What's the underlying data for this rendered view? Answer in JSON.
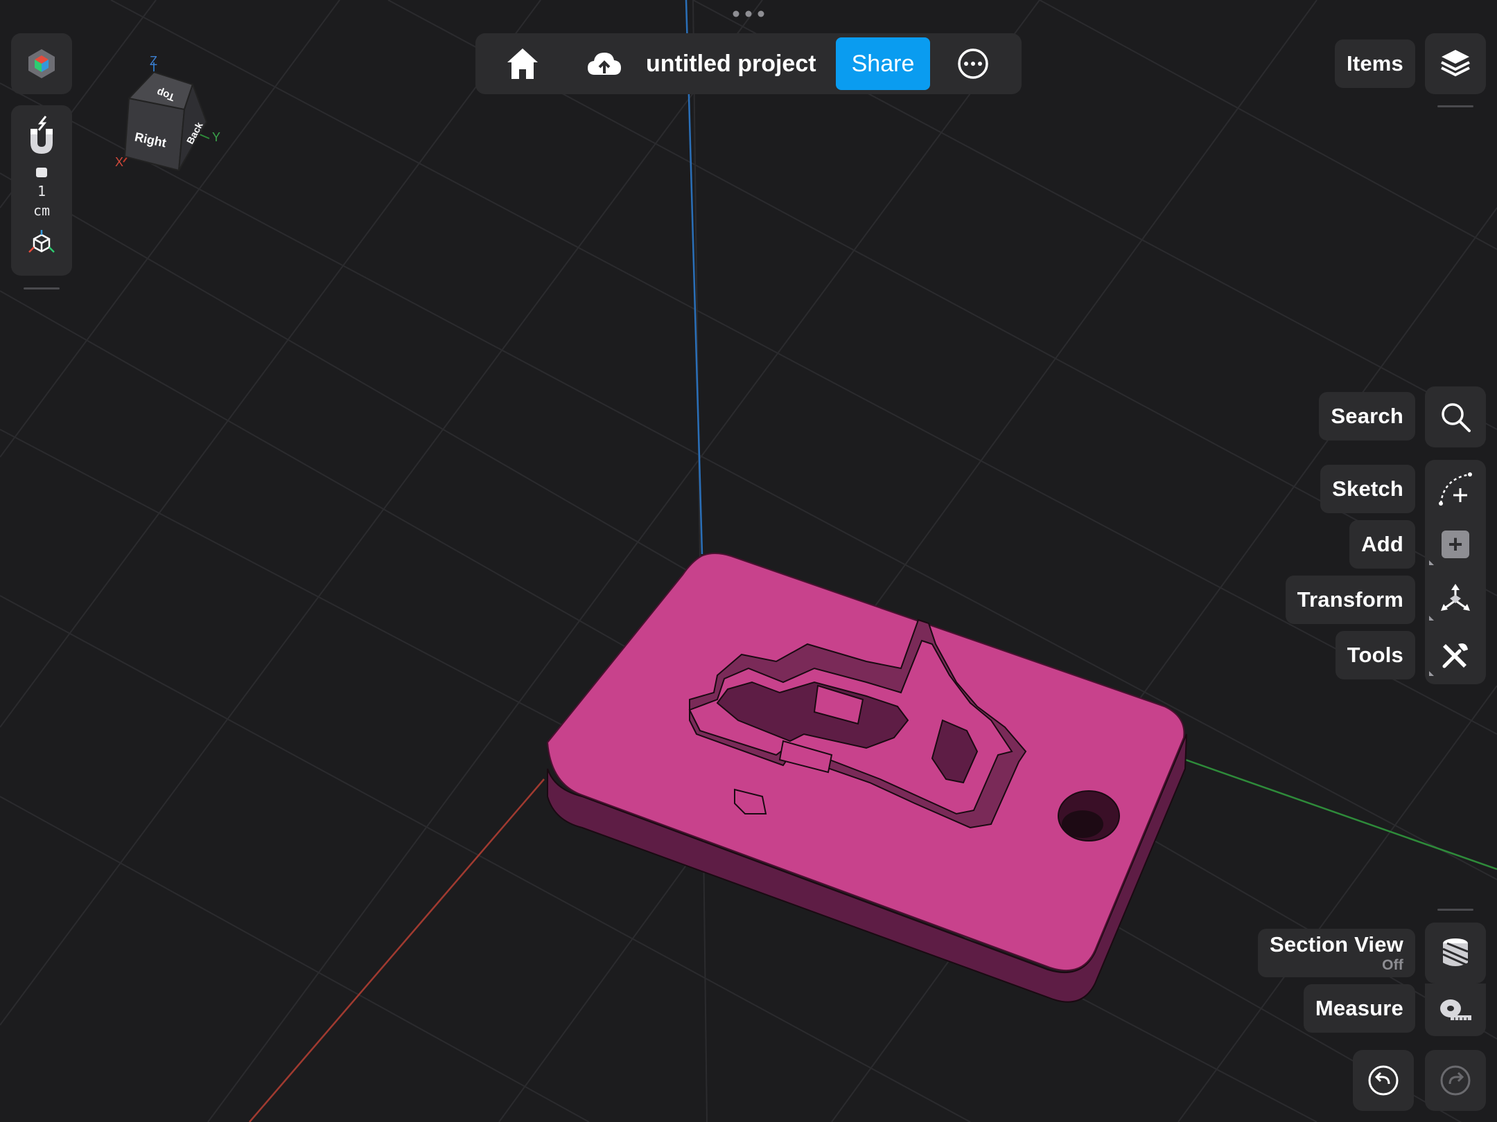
{
  "app": {
    "project_title": "untitled project",
    "share_label": "Share"
  },
  "left_toolbar": {
    "snap_value": "1",
    "snap_unit": "cm"
  },
  "view_cube": {
    "face_top": "Top",
    "face_right": "Right",
    "face_back": "Back",
    "axis_x": "X",
    "axis_y": "Y",
    "axis_z": "Z"
  },
  "right_toolbar": {
    "items_label": "Items",
    "search_label": "Search",
    "sketch_label": "Sketch",
    "add_label": "Add",
    "transform_label": "Transform",
    "tools_label": "Tools",
    "section_view_label": "Section View",
    "section_view_state": "Off",
    "measure_label": "Measure"
  },
  "colors": {
    "background": "#1c1c1e",
    "panel": "#2c2c2e",
    "accent": "#0a9cf0",
    "model_top": "#c8428c",
    "model_side": "#5e1d45",
    "axis_x": "#c0392b",
    "axis_y": "#2e8b3a",
    "axis_z": "#2a6fb8"
  },
  "icons": [
    "app-logo-icon",
    "magnet-icon",
    "lock-icon",
    "cube-axes-icon",
    "home-icon",
    "cloud-upload-icon",
    "more-icon",
    "layers-icon",
    "search-icon",
    "sketch-icon",
    "add-icon",
    "transform-icon",
    "tools-icon",
    "section-view-icon",
    "measure-icon",
    "undo-icon",
    "redo-icon"
  ]
}
